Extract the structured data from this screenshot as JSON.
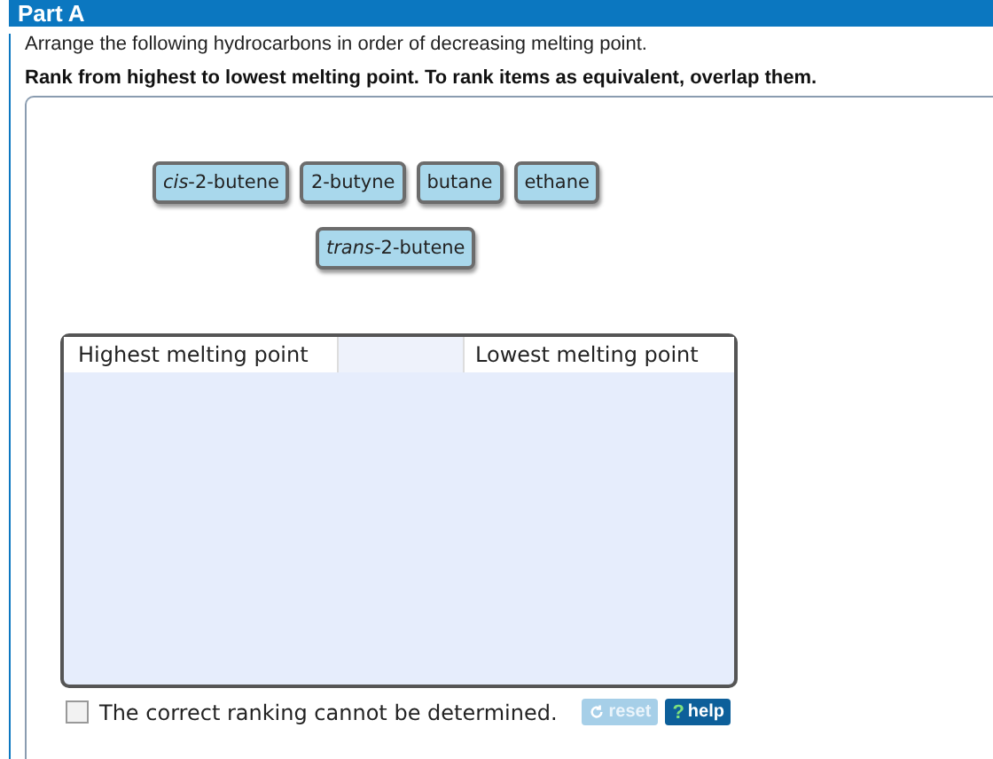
{
  "header": {
    "title": "Part A"
  },
  "instruction": "Arrange the following hydrocarbons in order of decreasing melting point.",
  "rank_instruction": "Rank from highest to lowest melting point. To rank items as equivalent, overlap them.",
  "tile_rows": [
    [
      {
        "label": "*cis*-2-butene"
      },
      {
        "label": "2-butyne"
      },
      {
        "label": "butane"
      },
      {
        "label": "ethane"
      }
    ],
    [
      {
        "label": "*trans*-2-butene"
      }
    ]
  ],
  "ranking_box": {
    "left_label": "Highest melting point",
    "right_label": "Lowest melting point"
  },
  "cannot_determine": {
    "label": "The correct ranking cannot be determined.",
    "checked": false
  },
  "buttons": [
    {
      "label": "reset",
      "kind": "reset",
      "disabled": true
    },
    {
      "label": "help",
      "kind": "help",
      "disabled": false,
      "icon": "?"
    }
  ]
}
